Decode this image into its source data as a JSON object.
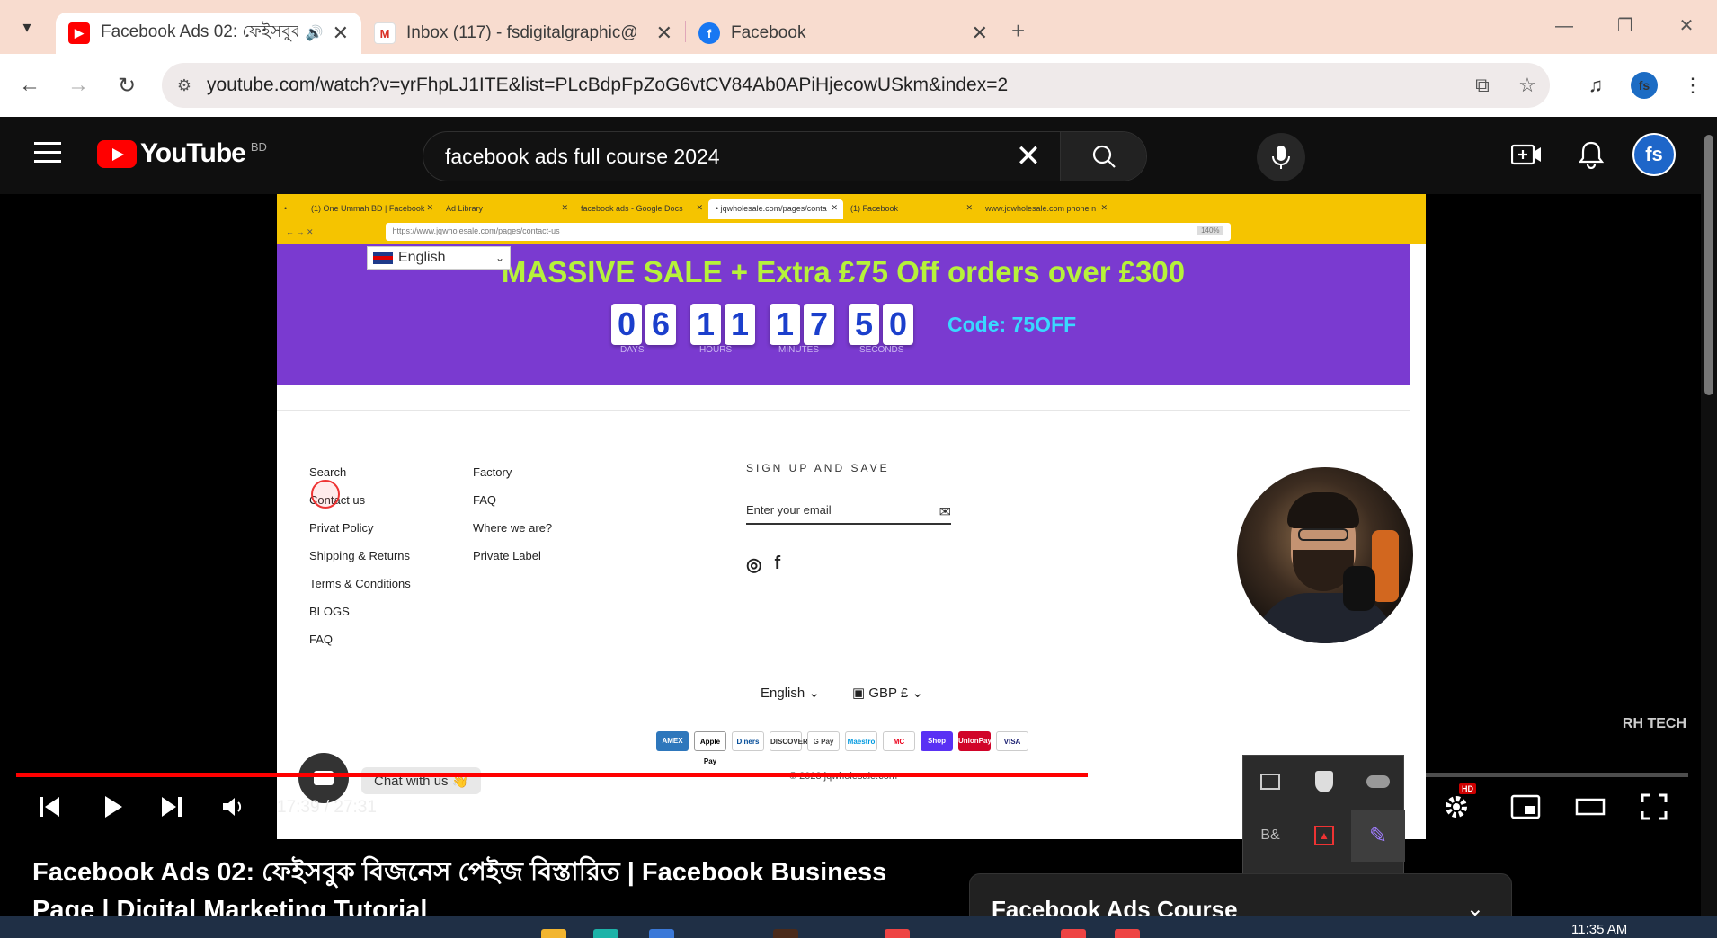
{
  "browser": {
    "tabs": [
      {
        "title": "Facebook Ads 02: ফেইসবুক",
        "favicon": "youtube-icon",
        "active": true
      },
      {
        "title": "Inbox (117) - fsdigitalgraphic@",
        "favicon": "gmail-icon",
        "active": false
      },
      {
        "title": "Facebook",
        "favicon": "facebook-icon",
        "active": false
      }
    ],
    "url": "youtube.com/watch?v=yrFhpLJ1ITE&list=PLcBdpFpZoG6vtCV84Ab0APiHjecowUSkm&index=2",
    "profile_initials": "fs"
  },
  "youtube": {
    "logo_text": "YouTube",
    "country_code": "BD",
    "search_query": "facebook ads full course 2024",
    "avatar_text": "fs"
  },
  "inner_browser": {
    "tabs": [
      "(1) One Ummah BD | Facebook",
      "Ad Library",
      "facebook ads - Google Docs",
      "• jqwholesale.com/pages/conta",
      "(1) Facebook",
      "www.jqwholesale.com phone n"
    ],
    "url": "https://www.jqwholesale.com/pages/contact-us",
    "zoom": "140%"
  },
  "site": {
    "language_select": "English",
    "headline": "MASSIVE SALE + Extra £75 Off orders over £300",
    "countdown": {
      "digits": [
        "0",
        "6",
        "1",
        "1",
        "1",
        "7",
        "5",
        "0"
      ],
      "labels": [
        "DAYS",
        "HOURS",
        "MINUTES",
        "SECONDS"
      ]
    },
    "code": "Code: 75OFF",
    "footer_col1": [
      "Search",
      "Contact us",
      "Privat Policy",
      "Shipping & Returns",
      "Terms & Conditions",
      "BLOGS",
      "FAQ"
    ],
    "footer_col2": [
      "Factory",
      "FAQ",
      "Where we are?",
      "Private Label"
    ],
    "signup_title": "SIGN UP AND SAVE",
    "email_placeholder": "Enter your email",
    "lang_footer": "English",
    "currency": "GBP £",
    "payments": [
      "AMEX",
      "Apple Pay",
      "Diners",
      "DISCOVER",
      "G Pay",
      "Maestro",
      "MC",
      "Shop Pay",
      "UnionPay",
      "VISA"
    ],
    "copyright": "© 2023 jqwholesale.com",
    "chat_label": "Chat with us 👋",
    "watermark": "RH TECH"
  },
  "player": {
    "time": "17:39 / 27:31",
    "progress_played": 0.641,
    "progress_loaded": 0.7,
    "hd_badge": "HD"
  },
  "video_title": "Facebook Ads 02: ফেইসবুক বিজনেস পেইজ বিস্তারিত | Facebook Business Page | Digital Marketing Tutorial",
  "playlist_card_title": "Facebook Ads Course",
  "clock": "11:35 AM",
  "colors": {
    "youtube_red": "#ff0000",
    "promo_purple": "#7a3ad0",
    "headline_green": "#b6f23a",
    "code_cyan": "#39d8ff"
  }
}
